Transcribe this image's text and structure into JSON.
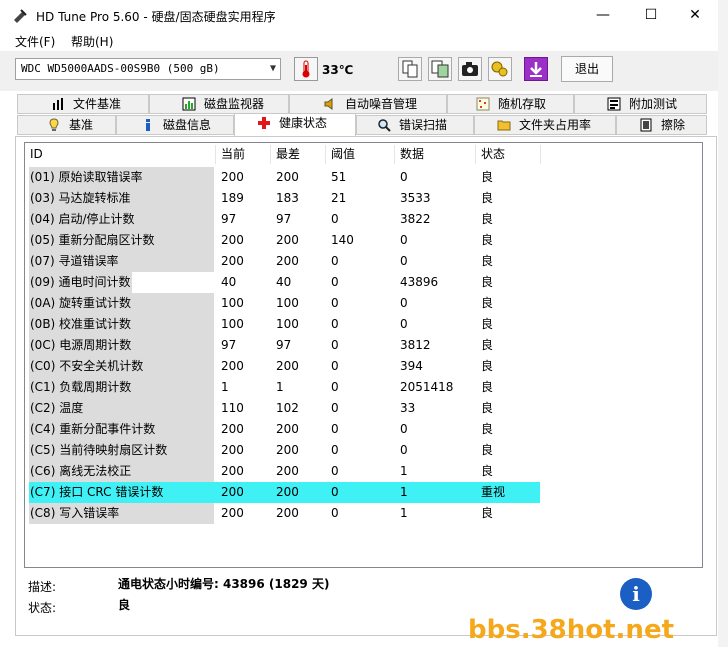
{
  "window": {
    "title": "HD Tune Pro 5.60 - 硬盘/固态硬盘实用程序",
    "min_glyph": "—",
    "max_glyph": "☐",
    "close_glyph": "✕"
  },
  "menu": [
    {
      "label": "文件(F)"
    },
    {
      "label": "帮助(H)"
    }
  ],
  "toolbar": {
    "drive": "WDC WD5000AADS-00S9B0 (500 gB)",
    "temperature": "33℃",
    "exit_label": "退出",
    "icons": [
      "copy-info-icon",
      "copy-screen-icon",
      "screenshot-camera-icon",
      "options-icon",
      "download-icon"
    ]
  },
  "tabs_row1": [
    {
      "label": "文件基准",
      "icon": "file-benchmark-icon"
    },
    {
      "label": "磁盘监视器",
      "icon": "disk-monitor-icon"
    },
    {
      "label": "自动噪音管理",
      "icon": "noise-speaker-icon"
    },
    {
      "label": "随机存取",
      "icon": "random-access-icon"
    },
    {
      "label": "附加测试",
      "icon": "extra-tests-icon"
    }
  ],
  "tabs_row2": [
    {
      "label": "基准",
      "icon": "benchmark-icon"
    },
    {
      "label": "磁盘信息",
      "icon": "info-icon"
    },
    {
      "label": "健康状态",
      "icon": "health-cross-icon"
    },
    {
      "label": "错误扫描",
      "icon": "error-scan-magnifier-icon"
    },
    {
      "label": "文件夹占用率",
      "icon": "folder-icon"
    },
    {
      "label": "擦除",
      "icon": "erase-icon"
    }
  ],
  "smart_table": {
    "columns": [
      "ID",
      "当前",
      "最差",
      "阈值",
      "数据",
      "状态"
    ],
    "rows": [
      [
        "(01) 原始读取错误率",
        "200",
        "200",
        "51",
        "0",
        "良"
      ],
      [
        "(03) 马达旋转标准",
        "189",
        "183",
        "21",
        "3533",
        "良"
      ],
      [
        "(04) 启动/停止计数",
        "97",
        "97",
        "0",
        "3822",
        "良"
      ],
      [
        "(05) 重新分配扇区计数",
        "200",
        "200",
        "140",
        "0",
        "良"
      ],
      [
        "(07) 寻道错误率",
        "200",
        "200",
        "0",
        "0",
        "良"
      ],
      [
        "(09) 通电时间计数",
        "40",
        "40",
        "0",
        "43896",
        "良"
      ],
      [
        "(0A) 旋转重试计数",
        "100",
        "100",
        "0",
        "0",
        "良"
      ],
      [
        "(0B) 校准重试计数",
        "100",
        "100",
        "0",
        "0",
        "良"
      ],
      [
        "(0C) 电源周期计数",
        "97",
        "97",
        "0",
        "3812",
        "良"
      ],
      [
        "(C0) 不安全关机计数",
        "200",
        "200",
        "0",
        "394",
        "良"
      ],
      [
        "(C1) 负载周期计数",
        "1",
        "1",
        "0",
        "2051418",
        "良"
      ],
      [
        "(C2) 温度",
        "110",
        "102",
        "0",
        "33",
        "良"
      ],
      [
        "(C4) 重新分配事件计数",
        "200",
        "200",
        "0",
        "0",
        "良"
      ],
      [
        "(C5) 当前待映射扇区计数",
        "200",
        "200",
        "0",
        "0",
        "良"
      ],
      [
        "(C6) 离线无法校正",
        "200",
        "200",
        "0",
        "1",
        "良"
      ],
      [
        "(C7) 接口 CRC 错误计数",
        "200",
        "200",
        "0",
        "1",
        "重视"
      ],
      [
        "(C8) 写入错误率",
        "200",
        "200",
        "0",
        "1",
        "良"
      ]
    ],
    "highlight_color": "#3ff0f5"
  },
  "details": {
    "desc_label": "描述:",
    "desc_value": "通电状态小时编号: 43896 (1829 天)",
    "status_label": "状态:",
    "status_value": "良"
  },
  "info_glyph": "i",
  "watermark": "bbs.38hot.net"
}
